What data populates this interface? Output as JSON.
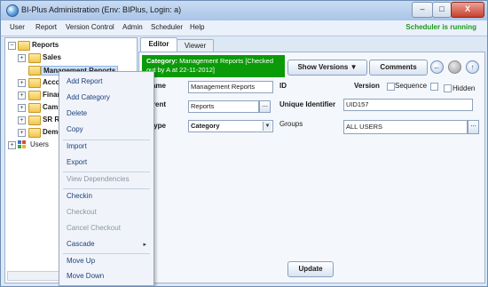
{
  "window": {
    "title": "BI-Plus Administration (Env: BIPlus, Login: a)",
    "minimize": "–",
    "maximize": "□",
    "close": "X"
  },
  "menubar": {
    "items": [
      "User",
      "Report",
      "Version Control",
      "Admin",
      "Scheduler",
      "Help"
    ],
    "status": "Scheduler is running"
  },
  "tree": {
    "root": "Reports",
    "items": [
      {
        "label": "Sales"
      },
      {
        "label": "Management Reports"
      },
      {
        "label": "Accou"
      },
      {
        "label": "Finan"
      },
      {
        "label": "Camp"
      },
      {
        "label": "SR Re"
      },
      {
        "label": "Demo"
      }
    ],
    "users_label": "Users"
  },
  "context_menu": {
    "items": [
      {
        "label": "Add Report",
        "enabled": true
      },
      {
        "label": "Add Category",
        "enabled": true
      },
      {
        "label": "Delete",
        "enabled": true
      },
      {
        "label": "Copy",
        "enabled": true
      },
      {
        "label": "Import",
        "enabled": true
      },
      {
        "label": "Export",
        "enabled": true
      },
      {
        "label": "View Dependencies",
        "enabled": false
      },
      {
        "label": "Checkin",
        "enabled": true
      },
      {
        "label": "Checkout",
        "enabled": false
      },
      {
        "label": "Cancel Checkout",
        "enabled": false
      },
      {
        "label": "Cascade",
        "enabled": true
      },
      {
        "label": "Move Up",
        "enabled": true
      },
      {
        "label": "Move Down",
        "enabled": true
      }
    ],
    "submenu_arrow": "▸"
  },
  "tabs": [
    "Editor",
    "Viewer"
  ],
  "editor": {
    "banner_bold": "Category:",
    "banner_text": "Management Reports [Checked out by A at 22-11-2012]",
    "show_versions": "Show Versions",
    "show_versions_arrow": "▼",
    "comments": "Comments",
    "nav_back": "←",
    "nav_up": "↑",
    "name_label": "Name",
    "name_value": "Management Reports",
    "id_label": "ID",
    "version_label": "Version",
    "sequence_label": "Sequence",
    "hidden_label": "Hidden",
    "parent_label": "Parent",
    "parent_value": "Reports",
    "uid_label": "Unique Identifier",
    "uid_value": "UID157",
    "type_label": "Type",
    "type_value": "Category",
    "groups_label": "Groups",
    "groups_value": "ALL USERS",
    "dots": "...",
    "select_arrow": "▼",
    "update": "Update"
  }
}
